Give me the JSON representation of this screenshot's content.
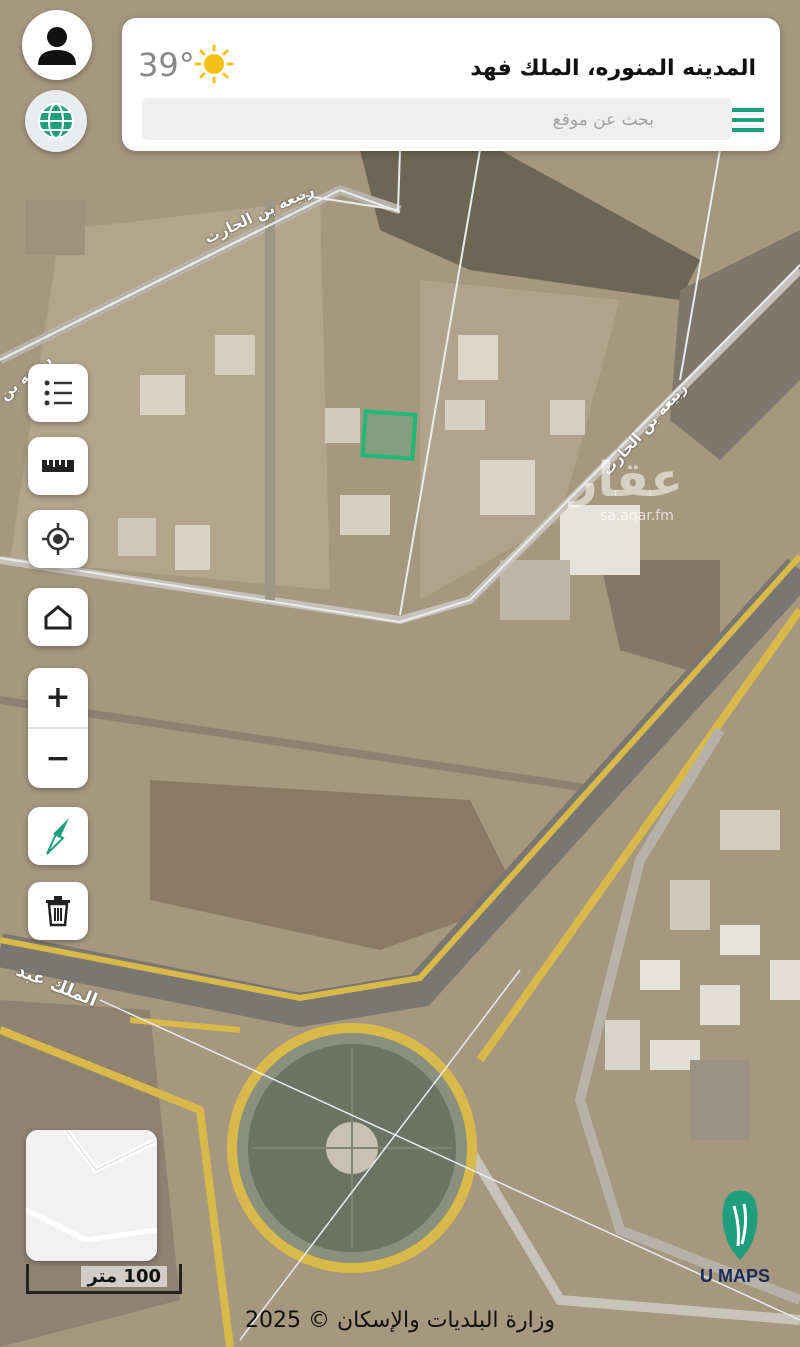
{
  "header": {
    "location_title": "المدينه المنوره، الملك فهد",
    "temperature": "39°",
    "weather_icon": "sun-icon",
    "search_placeholder": "بحث عن موقع"
  },
  "map": {
    "road_labels": {
      "rabia_1": "ربيعه بن الحارث",
      "rabia_2": "ربيعه بن",
      "rabia_3": "ربيعه بن الحارث",
      "malik_abd": "الملك عبد"
    },
    "watermark": "عقار",
    "watermark_sub": "sa.aqar.fm",
    "scale_label": "100 متر",
    "copyright": "وزارة البلديات والإسكان © 2025",
    "brand": "U MAPS",
    "colors": {
      "highlight": "#1fb87a",
      "brand": "#1e9e7a",
      "main_road": "#d9b94a"
    }
  },
  "controls": {
    "profile": "user-icon",
    "layers": "globe-icon",
    "legend": "list-icon",
    "measure": "ruler-icon",
    "locate": "locate-icon",
    "home": "home-icon",
    "zoom_in": "+",
    "zoom_out": "−",
    "compass": "compass-icon",
    "delete": "trash-icon"
  }
}
